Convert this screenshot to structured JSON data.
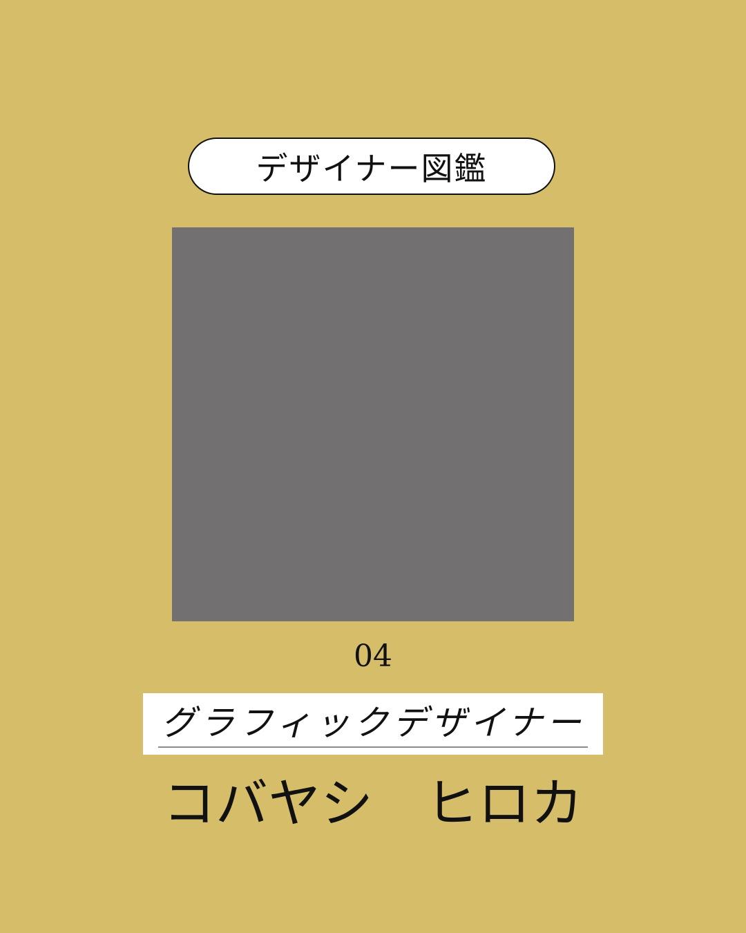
{
  "header": {
    "series_title": "デザイナー図鑑"
  },
  "profile": {
    "number": "04",
    "role": "グラフィックデザイナー",
    "name": "コバヤシ　ヒロカ"
  },
  "colors": {
    "background": "#d6bd69",
    "photo_placeholder": "#727071",
    "text": "#111111",
    "panel": "#ffffff"
  }
}
